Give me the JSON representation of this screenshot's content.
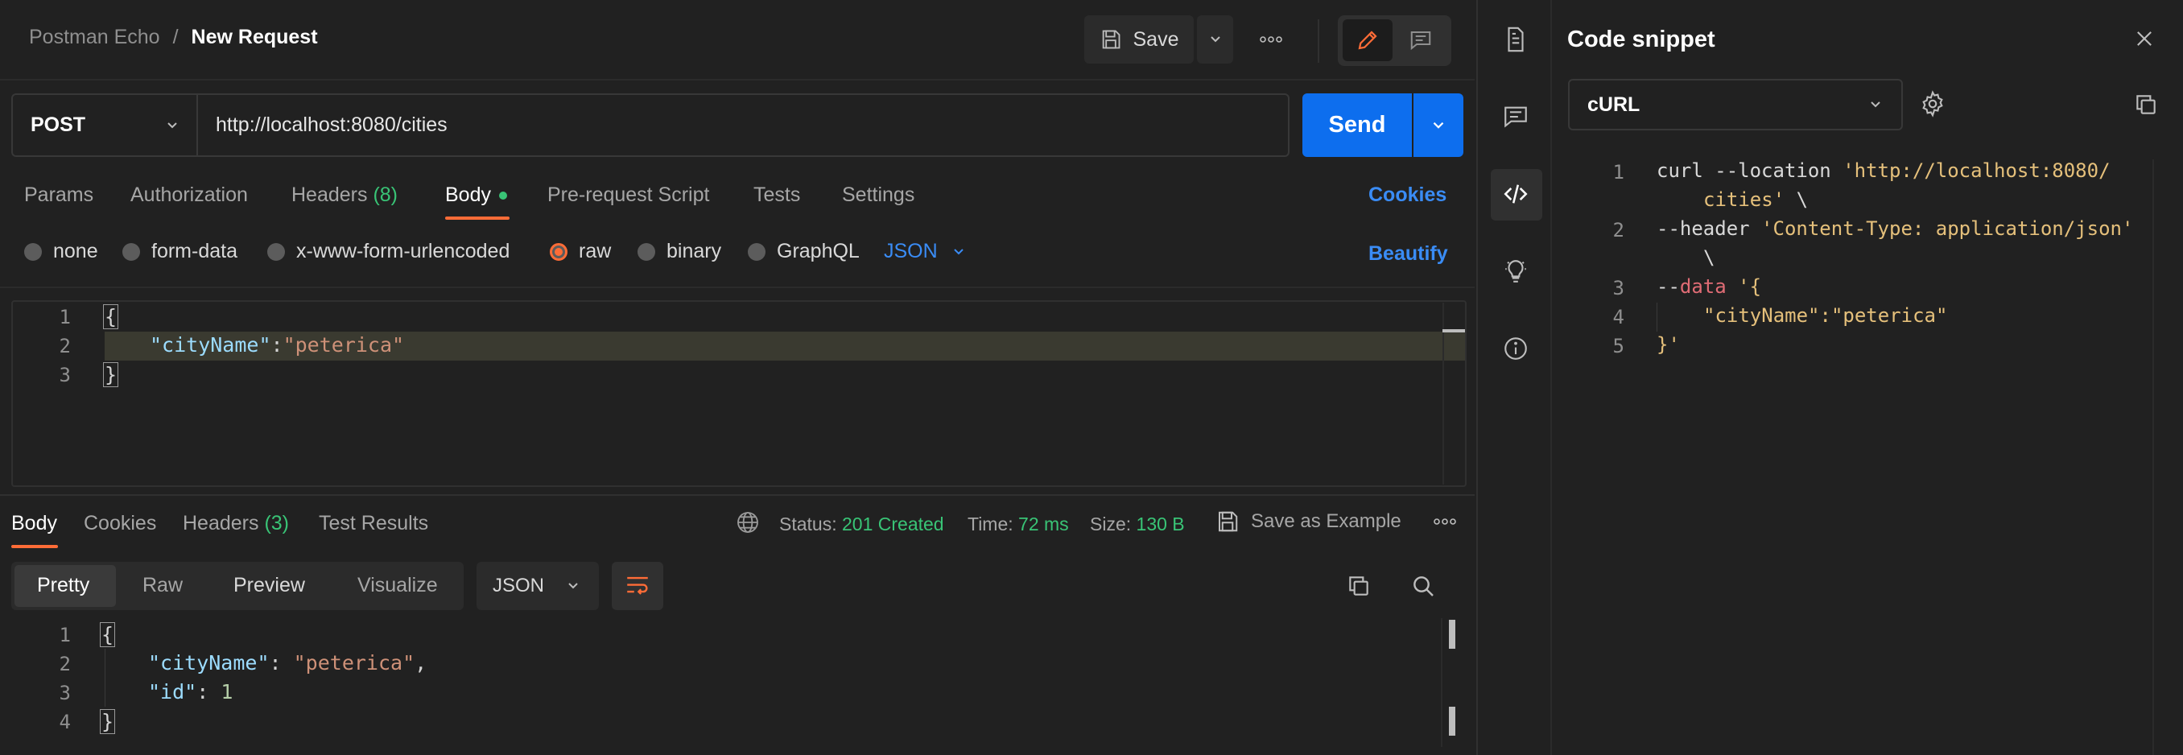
{
  "header": {
    "breadcrumb_parent": "Postman Echo",
    "breadcrumb_sep": "/",
    "breadcrumb_current": "New Request",
    "save_label": "Save"
  },
  "request": {
    "method": "POST",
    "url": "http://localhost:8080/cities",
    "send_label": "Send",
    "tabs": [
      {
        "label": "Params"
      },
      {
        "label": "Authorization"
      },
      {
        "label": "Headers",
        "count": "(8)"
      },
      {
        "label": "Body"
      },
      {
        "label": "Pre-request Script"
      },
      {
        "label": "Tests"
      },
      {
        "label": "Settings"
      }
    ],
    "cookies_label": "Cookies",
    "body_types": [
      "none",
      "form-data",
      "x-www-form-urlencoded",
      "raw",
      "binary",
      "GraphQL"
    ],
    "body_format": "JSON",
    "beautify_label": "Beautify",
    "editor": {
      "line_numbers": [
        "1",
        "2",
        "3"
      ],
      "open_brace": "{",
      "key": "\"cityName\"",
      "colon": ":",
      "value": "\"peterica\"",
      "close_brace": "}"
    }
  },
  "response": {
    "tabs": [
      {
        "label": "Body"
      },
      {
        "label": "Cookies"
      },
      {
        "label": "Headers",
        "count": "(3)"
      },
      {
        "label": "Test Results"
      }
    ],
    "status_label": "Status:",
    "status_value": "201 Created",
    "time_label": "Time:",
    "time_value": "72 ms",
    "size_label": "Size:",
    "size_value": "130 B",
    "save_example_label": "Save as Example",
    "view_modes": [
      "Pretty",
      "Raw",
      "Preview",
      "Visualize"
    ],
    "format": "JSON",
    "editor": {
      "line_numbers": [
        "1",
        "2",
        "3",
        "4"
      ],
      "open_brace": "{",
      "key1": "\"cityName\"",
      "sep1": ": ",
      "val1": "\"peterica\"",
      "comma": ",",
      "key2": "\"id\"",
      "sep2": ": ",
      "val2": "1",
      "close_brace": "}"
    }
  },
  "snippet": {
    "title": "Code snippet",
    "language": "cURL",
    "line_numbers": [
      "1",
      "2",
      "3",
      "4",
      "5"
    ],
    "l1_cmd": "curl --location ",
    "l1_url_a": "'http://localhost:8080/",
    "l1_url_b": "cities'",
    "l1_cont": " \\",
    "l2_flag": "--header ",
    "l2_val": "'Content-Type: application/json'",
    "l2_cont": "\\",
    "l3_dashes": "--",
    "l3_flag": "data",
    "l3_val": " '{",
    "l4_key": "\"cityName\"",
    "l4_colon": ":",
    "l4_val": "\"peterica\"",
    "l5_end": "}'"
  },
  "colors": {
    "accent": "#ff6c37",
    "send": "#0d6eee",
    "link": "#3a8cf5",
    "success": "#39c476"
  }
}
